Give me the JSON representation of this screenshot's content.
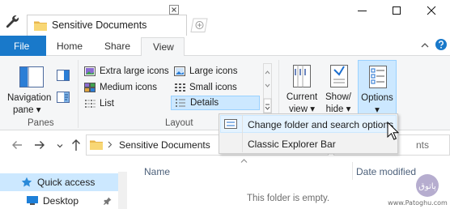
{
  "window": {
    "tab_title": "Sensitive Documents",
    "icons": [
      "wrench-icon",
      "folder-icon",
      "close-icon",
      "new-tab-icon",
      "minimize-icon",
      "maximize-icon",
      "close-window-icon"
    ]
  },
  "ribbon_tabs": {
    "file": "File",
    "home": "Home",
    "share": "Share",
    "view": "View",
    "active": "View"
  },
  "ribbon": {
    "panes": {
      "navigation_pane_line1": "Navigation",
      "navigation_pane_line2": "pane ▾",
      "label": "Panes"
    },
    "layout": {
      "items": [
        "Extra large icons",
        "Large icons",
        "Medium icons",
        "Small icons",
        "List",
        "Details"
      ],
      "selected": "Details",
      "label": "Layout"
    },
    "current_view": {
      "line1": "Current",
      "line2": "view ▾"
    },
    "show_hide": {
      "line1": "Show/",
      "line2": "hide ▾"
    },
    "options": {
      "line1": "Options",
      "line2": "▾"
    }
  },
  "address_bar": {
    "path": "Sensitive Documents",
    "search_placeholder_visible": "nts"
  },
  "options_menu": {
    "items": [
      "Change folder and search options",
      "Classic Explorer Bar"
    ]
  },
  "content": {
    "columns": [
      "Name",
      "Date modified"
    ],
    "empty_message": "This folder is empty."
  },
  "nav_pane": {
    "items": [
      "Quick access",
      "Desktop"
    ]
  },
  "watermark": {
    "text": "www.Patoghu.com",
    "logo_text": "پاتوق"
  },
  "colors": {
    "file_tab": "#1979ca",
    "selection_bg": "#cce8ff",
    "selection_border": "#99d1ff",
    "ribbon_bg": "#f5f6f7"
  }
}
